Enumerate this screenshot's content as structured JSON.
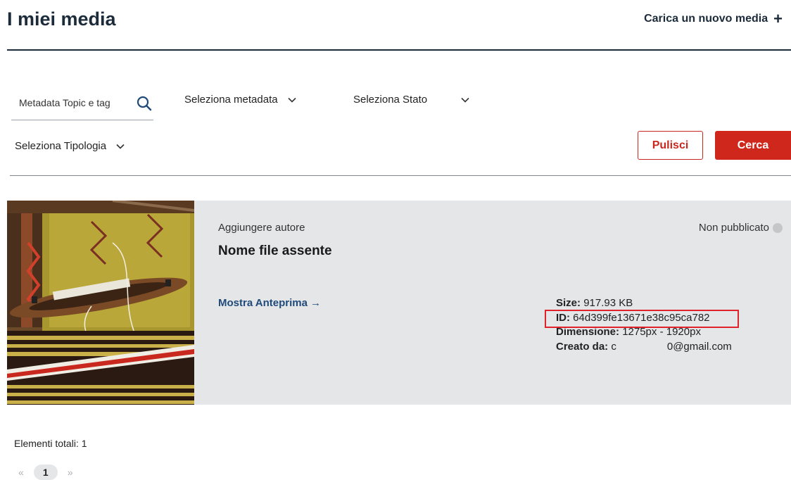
{
  "header": {
    "title": "I miei media",
    "upload_label": "Carica un nuovo media",
    "upload_icon": "plus-icon"
  },
  "filters": {
    "search_placeholder": "Metadata Topic e tag",
    "search_value": "",
    "search_icon": "search-icon",
    "metadata_select": "Seleziona metadata",
    "status_select": "Seleziona Stato",
    "type_select": "Seleziona Tipologia",
    "clear_label": "Pulisci",
    "search_label": "Cerca"
  },
  "colors": {
    "primary_red": "#d0271d",
    "navy": "#1c2b3a",
    "link_blue": "#1f4a7a",
    "card_bg": "#e4e6e8",
    "highlight_box": "#e0232a"
  },
  "media": {
    "author": "Aggiungere autore",
    "filename": "Nome file assente",
    "preview_label": "Mostra Anteprima",
    "preview_arrow": "→",
    "status": "Non pubblicato",
    "size_label": "Size:",
    "size_value": "917.93 KB",
    "id_label": "ID:",
    "id_value": "64d399fe13671e38c95ca782",
    "dimension_label": "Dimensione:",
    "dimension_value": "1275px - 1920px",
    "creator_label": "Creato da:",
    "creator_value_start": "c",
    "creator_value_end": "0@gmail.com"
  },
  "footer": {
    "total_label": "Elementi totali: 1",
    "pagination": {
      "prev": "«",
      "current": "1",
      "next": "»"
    }
  }
}
